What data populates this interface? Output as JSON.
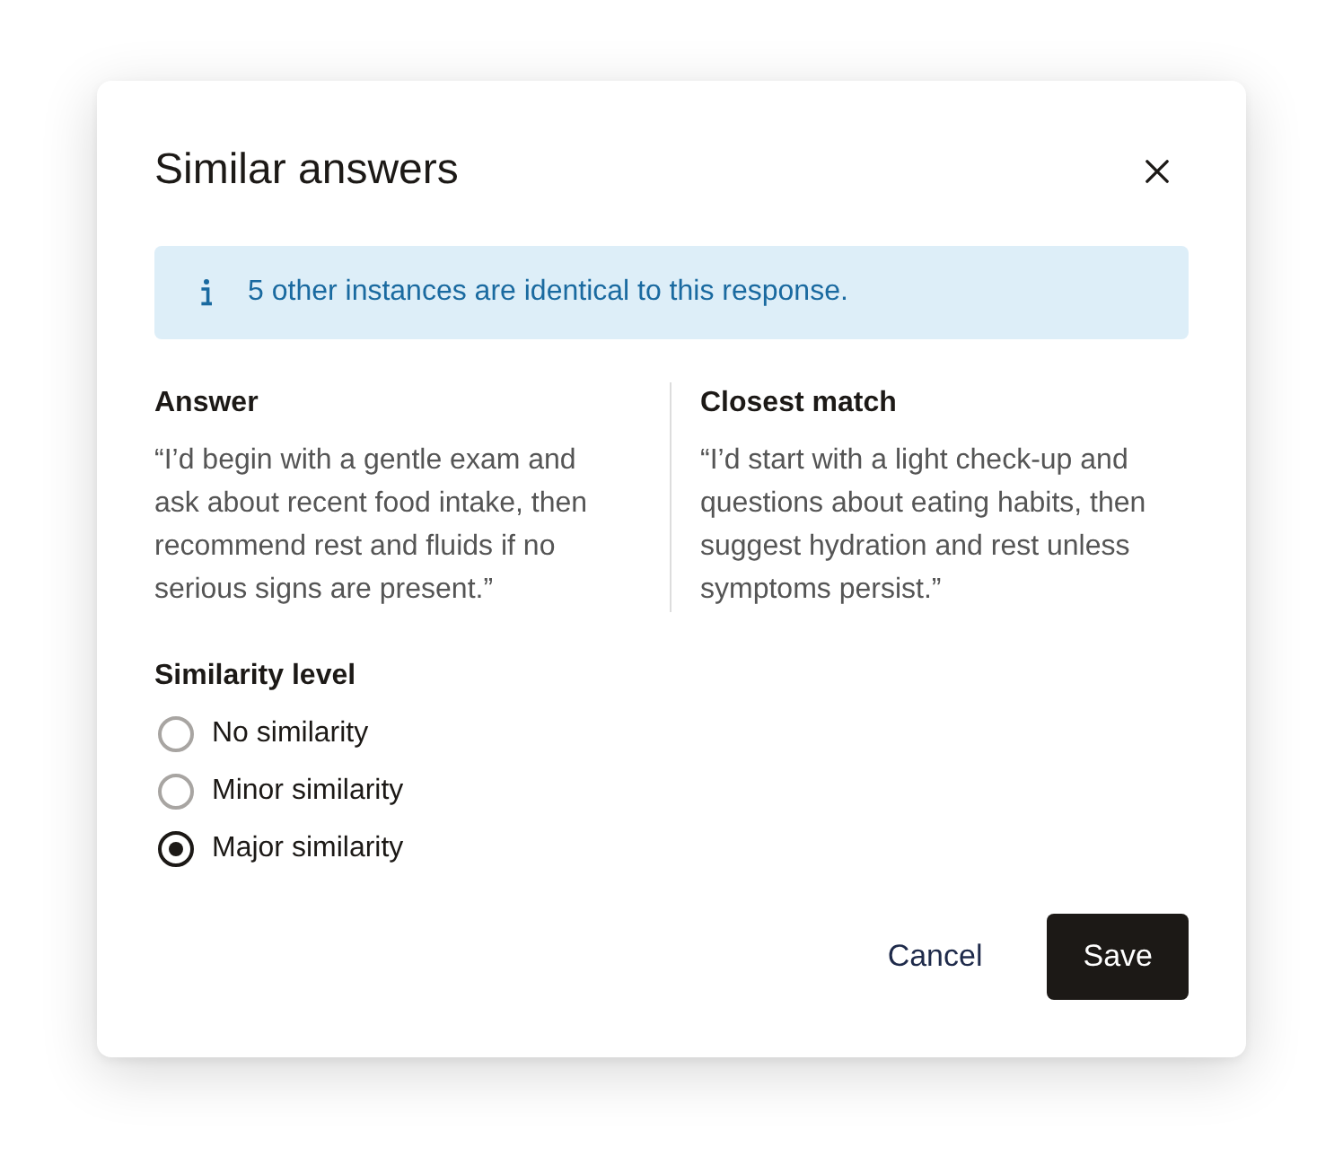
{
  "dialog": {
    "title": "Similar answers"
  },
  "banner": {
    "text": "5 other instances are identical to this response."
  },
  "comparison": [
    {
      "heading": "Answer",
      "text": "“I’d begin with a gentle exam and ask about recent food intake, then recommend rest and fluids if no serious signs are present.”"
    },
    {
      "heading": "Closest match",
      "text": "“I’d start with a light check-up and questions about eating habits, then suggest hydration and rest unless symptoms persist.”"
    }
  ],
  "similarity": {
    "label": "Similarity level",
    "options": [
      {
        "label": "No similarity",
        "selected": false
      },
      {
        "label": "Minor similarity",
        "selected": false
      },
      {
        "label": "Major similarity",
        "selected": true
      }
    ]
  },
  "buttons": [
    {
      "label": "Cancel",
      "kind": "text"
    },
    {
      "label": "Save",
      "kind": "primary"
    }
  ]
}
